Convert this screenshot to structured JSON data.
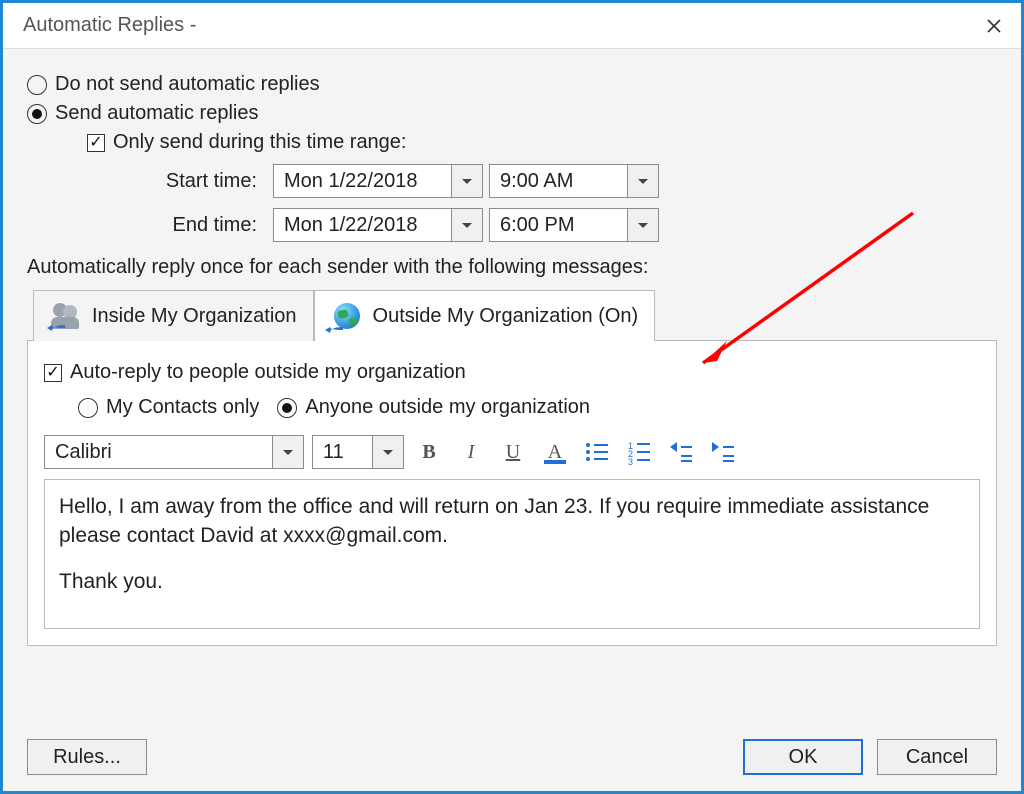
{
  "window": {
    "title": "Automatic Replies -"
  },
  "options": {
    "do_not_send": "Do not send automatic replies",
    "send": "Send automatic replies",
    "only_range": "Only send during this time range:"
  },
  "times": {
    "start_label": "Start time:",
    "start_date": "Mon 1/22/2018",
    "start_time": "9:00 AM",
    "end_label": "End time:",
    "end_date": "Mon 1/22/2018",
    "end_time": "6:00 PM"
  },
  "section_label": "Automatically reply once for each sender with the following messages:",
  "tabs": {
    "inside": "Inside My Organization",
    "outside": "Outside My Organization (On)"
  },
  "outside": {
    "auto_reply_check": "Auto-reply to people outside my organization",
    "contacts_only": "My Contacts only",
    "anyone": "Anyone outside my organization"
  },
  "format": {
    "font": "Calibri",
    "size": "11"
  },
  "message": {
    "body": "Hello, I am away from the office and will return on Jan 23. If you require immediate assistance please contact David at xxxx@gmail.com.",
    "signoff": "Thank you."
  },
  "buttons": {
    "rules": "Rules...",
    "ok": "OK",
    "cancel": "Cancel"
  }
}
